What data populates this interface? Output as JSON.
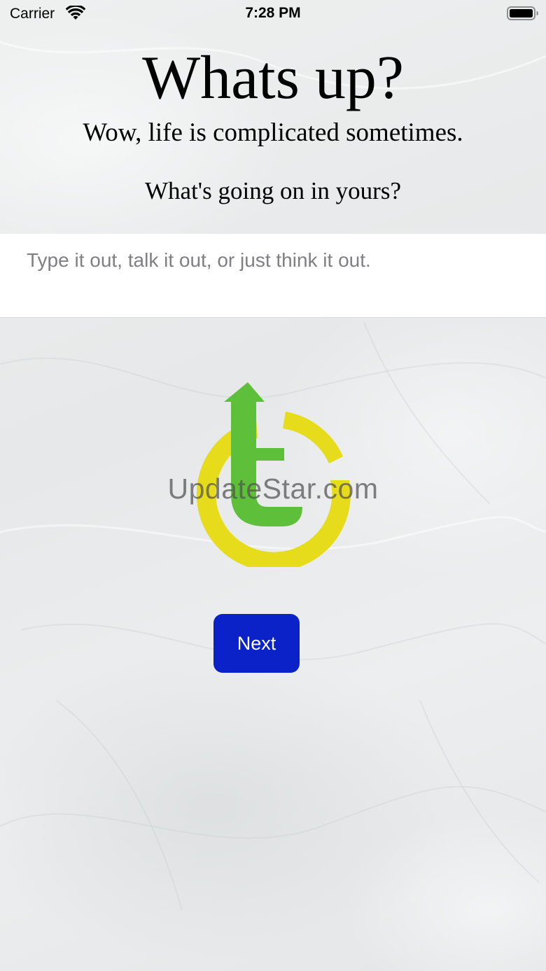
{
  "status_bar": {
    "carrier": "Carrier",
    "time": "7:28 PM",
    "icons": [
      "wifi-icon",
      "battery-icon"
    ]
  },
  "header": {
    "title": "Whats up?",
    "subtitle": "Wow, life is complicated sometimes.",
    "question": "What's going on in yours?"
  },
  "entry": {
    "value": "",
    "placeholder": "Type it out, talk it out, or just think it out."
  },
  "watermark": {
    "text": "UpdateStar.com",
    "logo_colors": {
      "arrow": "#5dbf3a",
      "ring": "#e6dc1c"
    }
  },
  "actions": {
    "next_label": "Next",
    "next_color": "#0a22c8"
  }
}
